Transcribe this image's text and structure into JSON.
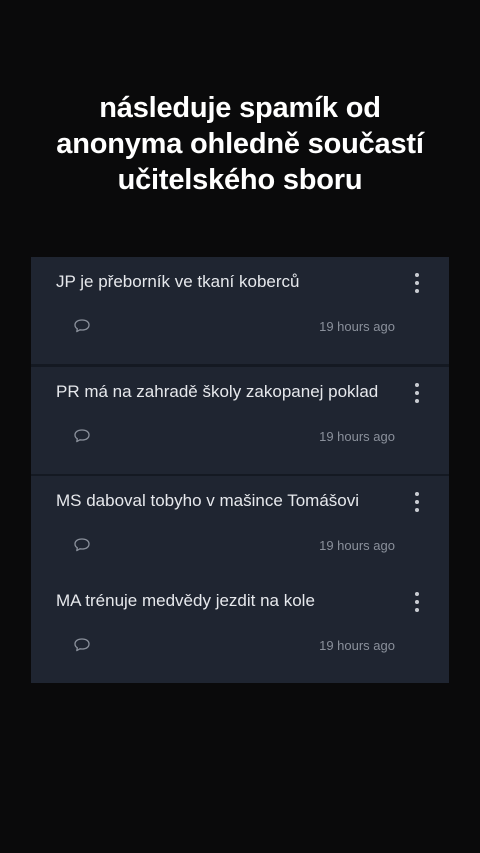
{
  "caption": {
    "lines": [
      "následuje spamík od",
      "anonyma ohledně součastí",
      "učitelského sboru"
    ]
  },
  "posts": [
    {
      "text": "JP je přeborník ve tkaní koberců",
      "time": "19 hours ago"
    },
    {
      "text": "PR má na zahradě školy zakopanej poklad",
      "time": "19 hours ago"
    },
    {
      "text": "MS daboval tobyho v mašince Tomášovi",
      "time": "19 hours ago"
    },
    {
      "text": "MA trénuje medvědy jezdit na kole",
      "time": "19 hours ago"
    }
  ],
  "icons": {
    "comment": "comment-bubble-icon",
    "more": "vertical-dots-menu-icon"
  },
  "colors": {
    "background": "#0a0a0b",
    "card": "#1f2531",
    "separator": "#141922",
    "caption_text": "#ffffff",
    "post_text": "#e6e8ec",
    "meta_text": "#8a909b"
  }
}
